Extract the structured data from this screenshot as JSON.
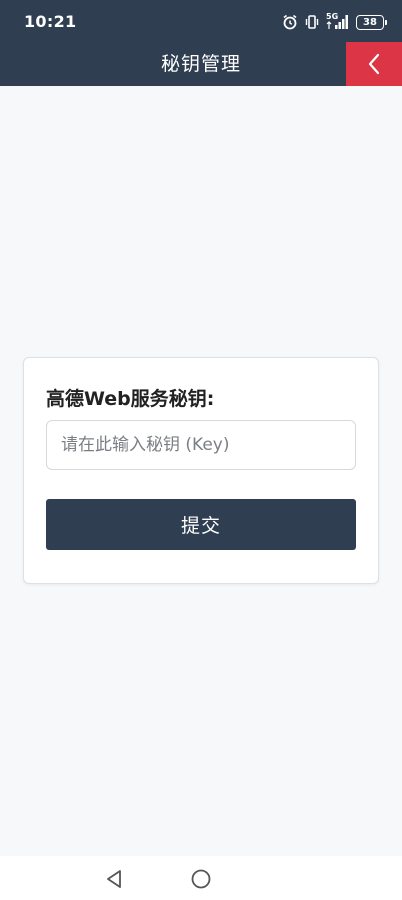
{
  "status_bar": {
    "time": "10:21",
    "network_label": "5G",
    "battery_level": "38"
  },
  "header": {
    "title": "秘钥管理"
  },
  "form": {
    "label": "高德Web服务秘钥:",
    "input_placeholder": "请在此输入秘钥 (Key)",
    "input_value": "",
    "submit_label": "提交"
  },
  "icons": {
    "back": "chevron-left-icon",
    "nav_back": "triangle-back-icon",
    "nav_home": "circle-home-icon"
  },
  "colors": {
    "header_bg": "#2f3e51",
    "back_button_bg": "#dc3545",
    "page_bg": "#f7f8fa",
    "submit_bg": "#2f3e51"
  }
}
